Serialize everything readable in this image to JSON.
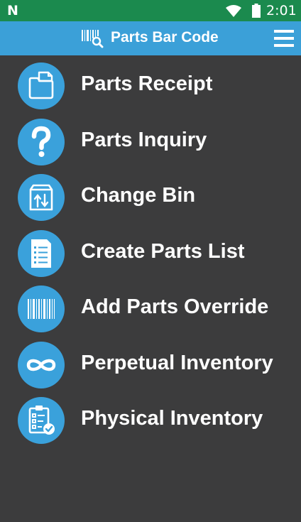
{
  "status_bar": {
    "notification_icon": "N",
    "time": "2:01",
    "icons": [
      "n-logo-icon",
      "wifi-icon",
      "battery-icon"
    ]
  },
  "app_bar": {
    "title": "Parts Bar Code",
    "icon": "barcode-search-icon",
    "menu_icon": "hamburger-menu-icon"
  },
  "colors": {
    "status_bar": "#1b8a4e",
    "app_bar": "#3ba0d8",
    "background": "#3c3c3d",
    "icon_circle": "#3aa1db",
    "text": "#ffffff"
  },
  "menu": {
    "items": [
      {
        "label": "Parts Receipt",
        "icon": "folder-icon"
      },
      {
        "label": "Parts Inquiry",
        "icon": "question-mark-icon"
      },
      {
        "label": "Change Bin",
        "icon": "bin-arrows-icon"
      },
      {
        "label": "Create Parts List",
        "icon": "checklist-document-icon"
      },
      {
        "label": "Add Parts Override",
        "icon": "barcode-icon"
      },
      {
        "label": "Perpetual Inventory",
        "icon": "infinity-icon"
      },
      {
        "label": "Physical Inventory",
        "icon": "clipboard-check-icon"
      }
    ]
  }
}
